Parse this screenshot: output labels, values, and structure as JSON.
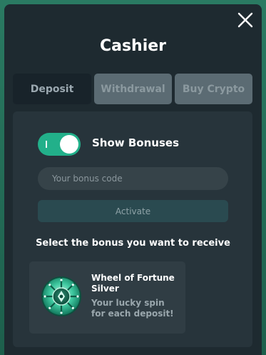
{
  "modal": {
    "title": "Cashier"
  },
  "tabs": [
    {
      "label": "Deposit",
      "active": true
    },
    {
      "label": "Withdrawal",
      "active": false
    },
    {
      "label": "Buy Crypto",
      "active": false
    }
  ],
  "bonuses": {
    "toggle_label": "Show Bonuses",
    "toggle_on": true,
    "code_input_placeholder": "Your bonus code",
    "code_input_value": "",
    "activate_label": "Activate",
    "select_label": "Select the bonus you want to receive",
    "items": [
      {
        "name": "Wheel of Fortune Silver",
        "description": "Your lucky spin for each deposit!",
        "icon": "wheel-of-fortune-icon"
      }
    ]
  },
  "colors": {
    "accent": "#22b08a",
    "modal_bg": "#1e2a30",
    "panel_bg": "#27343b",
    "backdrop": "#1f6b55"
  }
}
